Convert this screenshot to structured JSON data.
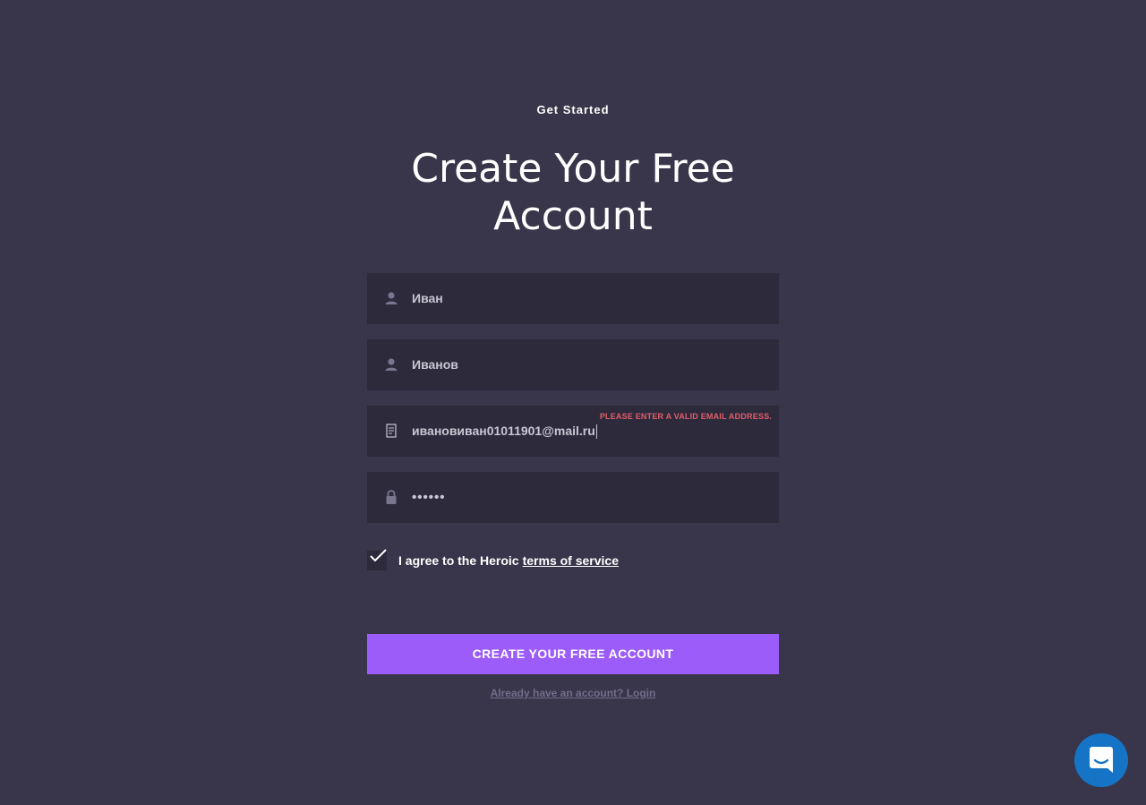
{
  "header": {
    "eyebrow": "Get Started",
    "title_line1": "Create Your Free",
    "title_line2": "Account"
  },
  "form": {
    "first_name": {
      "value": "Иван",
      "icon": "person-icon"
    },
    "last_name": {
      "value": "Иванов",
      "icon": "person-icon"
    },
    "email": {
      "value": "ивановиван01011901@mail.ru",
      "icon": "email-card-icon",
      "error": "PLEASE ENTER A VALID EMAIL ADDRESS."
    },
    "password": {
      "value": "••••••",
      "icon": "lock-icon"
    },
    "agree": {
      "checked": true,
      "text": "I agree to the Heroic",
      "link_text": "terms of service"
    },
    "submit_label": "CREATE YOUR FREE ACCOUNT",
    "login_link": "Already have an account? Login"
  },
  "colors": {
    "background": "#39354a",
    "field": "#2d2a3c",
    "accent": "#9b5cfa",
    "error": "#e25d69",
    "chat": "#1674c6"
  },
  "chat_widget": {
    "icon": "chat-icon"
  }
}
